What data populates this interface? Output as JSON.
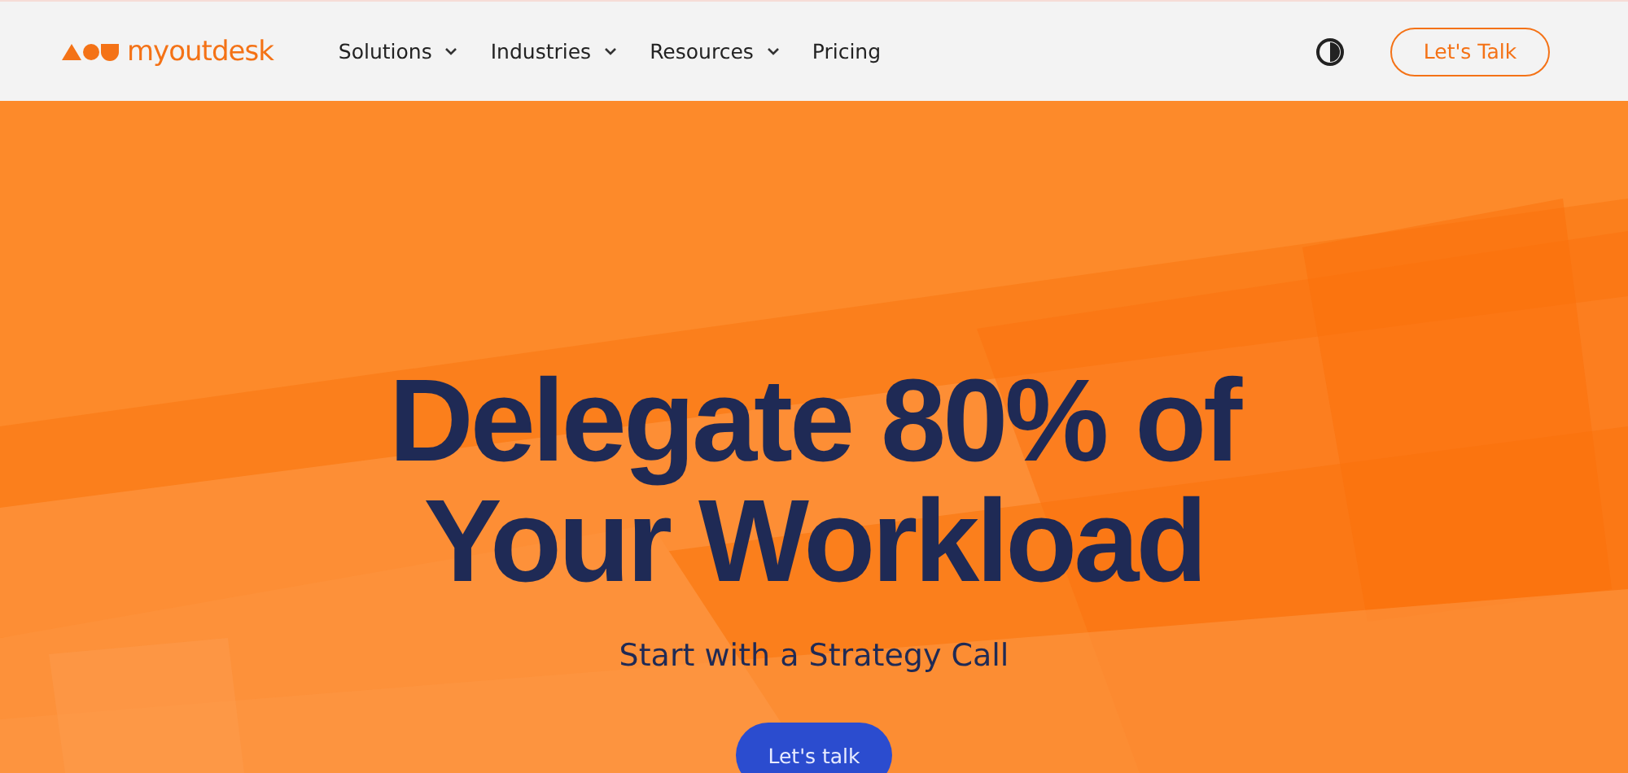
{
  "header": {
    "logo_text": "myoutdesk",
    "nav": [
      {
        "label": "Solutions",
        "dropdown": true
      },
      {
        "label": "Industries",
        "dropdown": true
      },
      {
        "label": "Resources",
        "dropdown": true
      },
      {
        "label": "Pricing",
        "dropdown": false
      }
    ],
    "cta": "Let's Talk"
  },
  "hero": {
    "headline": [
      "Delegate 80% of",
      "Your Workload"
    ],
    "subheadline": "Start with a Strategy Call",
    "button": "Let's talk"
  }
}
